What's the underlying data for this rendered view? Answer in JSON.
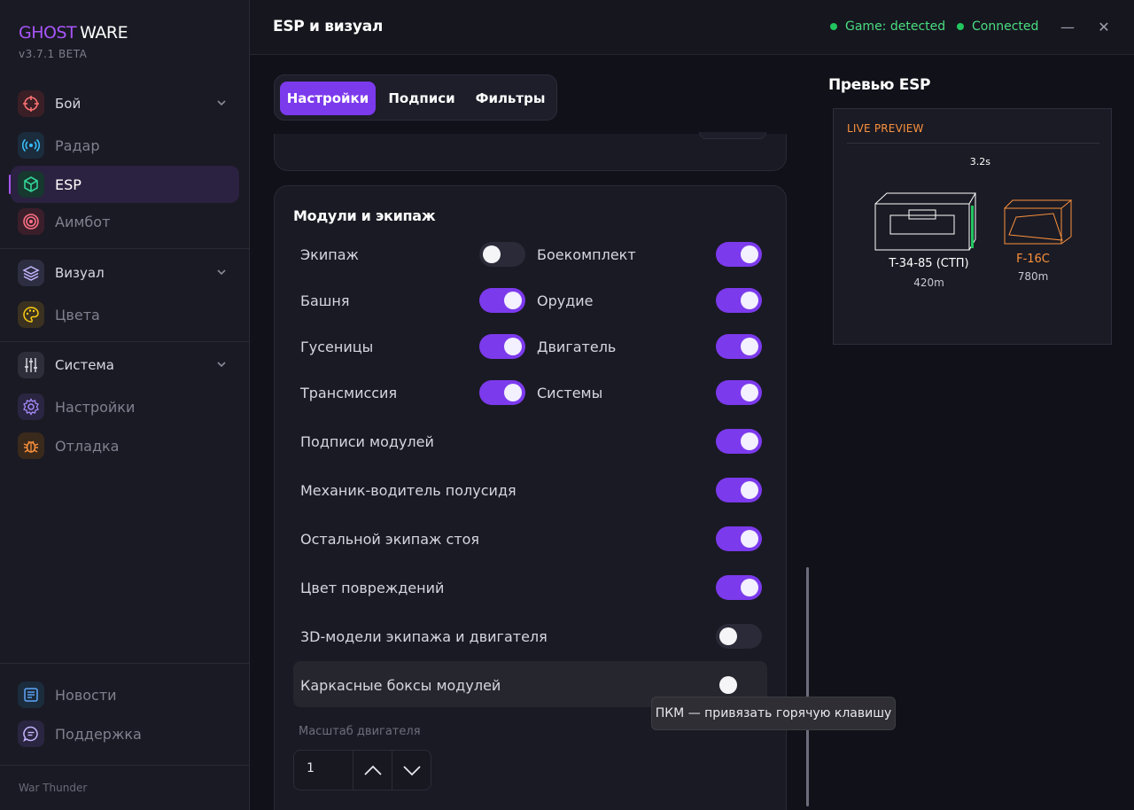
{
  "brand": {
    "part1": "GHOST",
    "part2": "WARE",
    "version": "v3.7.1 BETA"
  },
  "nav": [
    {
      "label": "Бой",
      "icon": "crosshair-icon",
      "group": true
    },
    {
      "label": "Радар",
      "icon": "radar-icon"
    },
    {
      "label": "ESP",
      "icon": "cube-icon",
      "active": true
    },
    {
      "label": "Аимбот",
      "icon": "target-icon"
    },
    {
      "label": "Визуал",
      "icon": "layers-icon",
      "group": true
    },
    {
      "label": "Цвета",
      "icon": "palette-icon"
    },
    {
      "label": "Система",
      "icon": "sliders-icon",
      "group": true
    },
    {
      "label": "Настройки",
      "icon": "gear-icon"
    },
    {
      "label": "Отладка",
      "icon": "bug-icon"
    }
  ],
  "bottom_nav": [
    {
      "label": "Новости",
      "icon": "news-icon"
    },
    {
      "label": "Поддержка",
      "icon": "chat-icon"
    }
  ],
  "game_footer": "War Thunder",
  "header": {
    "title": "ESP и визуал",
    "status_game": "Game: detected",
    "status_conn": "Connected",
    "minimize": "—",
    "close": "✕"
  },
  "tabs": [
    {
      "label": "Настройки",
      "active": true
    },
    {
      "label": "Подписи"
    },
    {
      "label": "Фильтры"
    }
  ],
  "modules": {
    "title": "Модули и экипаж",
    "grid": [
      {
        "label": "Экипаж",
        "on": false
      },
      {
        "label": "Боекомплект",
        "on": true
      },
      {
        "label": "Башня",
        "on": true
      },
      {
        "label": "Орудие",
        "on": true
      },
      {
        "label": "Гусеницы",
        "on": true
      },
      {
        "label": "Двигатель",
        "on": true
      },
      {
        "label": "Трансмиссия",
        "on": true
      },
      {
        "label": "Системы",
        "on": true
      }
    ],
    "rows": [
      {
        "label": "Подписи модулей",
        "on": true
      },
      {
        "label": "Механик-водитель полусидя",
        "on": true
      },
      {
        "label": "Остальной экипаж стоя",
        "on": true
      },
      {
        "label": "Цвет повреждений",
        "on": true
      },
      {
        "label": "3D-модели экипажа и двигателя",
        "on": false
      },
      {
        "label": "Каркасные боксы модулей",
        "on": false
      }
    ],
    "engine_scale_label": "Масштаб двигателя",
    "engine_scale_value": "1"
  },
  "tooltip": "ПКМ — привязать горячую клавишу",
  "preview": {
    "title": "Превью ESP",
    "live_label": "LIVE PREVIEW",
    "target1": {
      "name": "T-34-85 (СТП)",
      "distance": "420m",
      "timer": "3.2s",
      "color": "#ffffff"
    },
    "target2": {
      "name": "F-16C",
      "distance": "780m",
      "color": "#fb923c"
    }
  },
  "colors": {
    "accent": "#7c3aed",
    "brand": "#a855f7",
    "ok": "#22c55e",
    "enemy": "#fb923c"
  }
}
